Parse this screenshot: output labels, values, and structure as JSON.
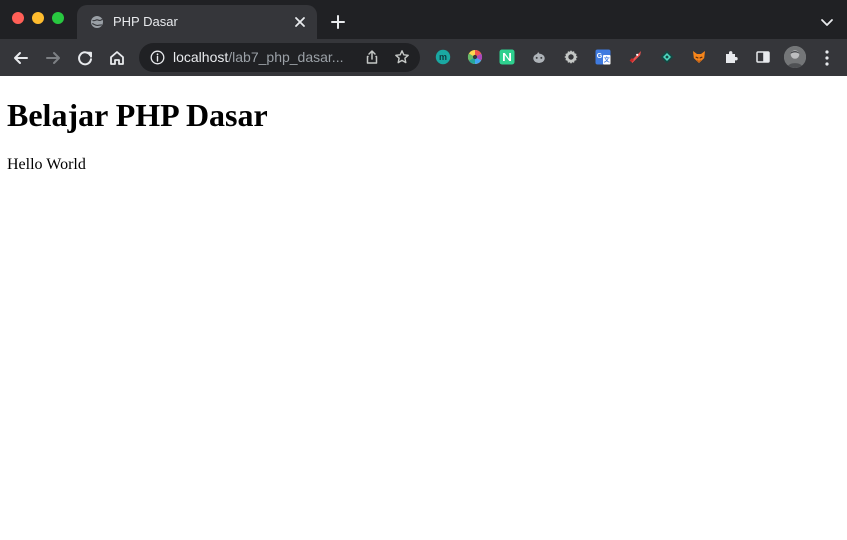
{
  "window": {
    "controls": [
      "close-dot",
      "minimize-dot",
      "maximize-dot"
    ]
  },
  "tab": {
    "title": "PHP Dasar",
    "favicon": "globe-icon",
    "close_icon": "close-icon"
  },
  "tabstrip": {
    "new_tab_icon": "plus-icon",
    "tab_search_icon": "chevron-down-icon"
  },
  "toolbar": {
    "back_icon": "back-arrow-icon",
    "forward_icon": "forward-arrow-icon",
    "reload_icon": "reload-icon",
    "home_icon": "home-icon",
    "address": {
      "host": "localhost",
      "path": "/lab7_php_dasar..."
    },
    "share_icon": "share-icon",
    "bookmark_icon": "star-icon",
    "extensions": [
      "teal-m-extension-icon",
      "color-wheel-extension-icon",
      "green-n-extension-icon",
      "gray-mascot-extension-icon",
      "gear-extension-icon",
      "translate-extension-icon",
      "rocket-extension-icon",
      "diamond-extension-icon",
      "fox-extension-icon",
      "puzzle-icon",
      "side-panel-icon"
    ],
    "profile_icon": "avatar",
    "menu_icon": "kebab-menu-icon"
  },
  "colors": {
    "titlebar": "#202124",
    "toolbar": "#35363a",
    "active_tab": "#35363a",
    "omnibox": "#202124",
    "tab_text": "#e8eaed",
    "url_host": "#e8eaed",
    "url_path": "#9aa0a6"
  },
  "page": {
    "heading": "Belajar PHP Dasar",
    "paragraph": "Hello World"
  }
}
